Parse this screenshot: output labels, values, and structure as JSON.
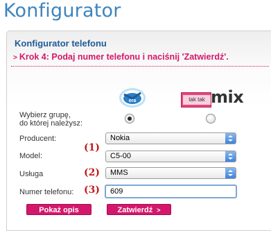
{
  "page": {
    "title": "Konfigurator"
  },
  "panel": {
    "heading": "Konfigurator telefonu",
    "step_marker": ">",
    "step_text": "Krok 4: Podaj numer telefonu i naciśnij 'Zatwierdź'."
  },
  "operators": {
    "label_line1": "Wybierz grupę,",
    "label_line2": "do której należysz:",
    "era": {
      "icon": "era-logo-icon",
      "logo_text": "era",
      "selected": true
    },
    "taktak": {
      "icon": "taktak-mix-logo-icon",
      "box_text": "tak tak",
      "mix_text": "mix",
      "selected": false
    }
  },
  "form": {
    "producer": {
      "label": "Producent:",
      "value": "Nokia"
    },
    "model": {
      "label": "Model:",
      "value": "C5-00",
      "marker": "(1)"
    },
    "service": {
      "label": "Usługa",
      "value": "MMS",
      "marker": "(2)"
    },
    "phone": {
      "label": "Numer telefonu:",
      "value": "609",
      "marker": "(3)"
    }
  },
  "buttons": {
    "show_desc": "Pokaż opis",
    "confirm": "Zatwierdź",
    "confirm_chevron": ">"
  },
  "colors": {
    "title": "#3e84bd",
    "heading": "#1f5a98",
    "accent": "#d4176b",
    "marker": "#c51c1c"
  }
}
